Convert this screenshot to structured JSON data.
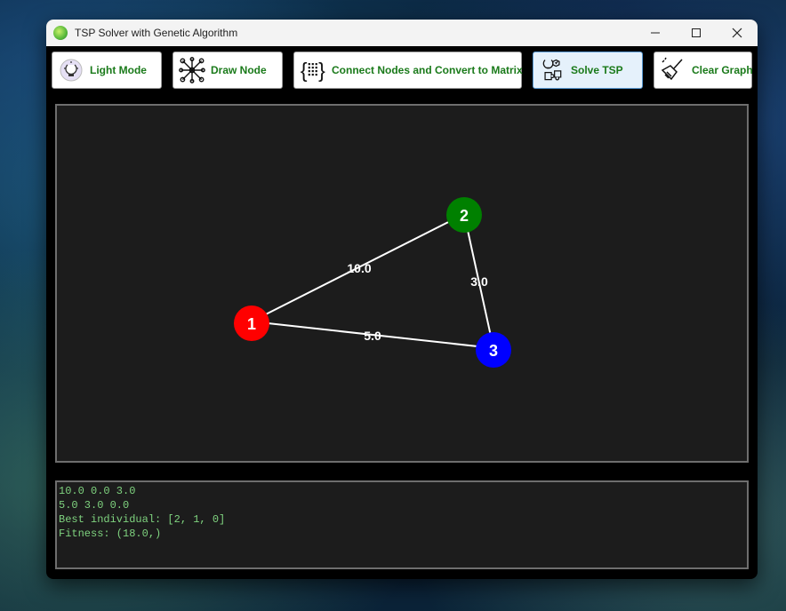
{
  "window": {
    "title": "TSP Solver with Genetic Algorithm",
    "controls": {
      "minimize": "—",
      "maximize": "☐",
      "close": "✕"
    }
  },
  "toolbar": {
    "buttons": [
      {
        "label": "Light Mode",
        "icon": "light-bulb-icon"
      },
      {
        "label": "Draw Node",
        "icon": "network-nodes-icon"
      },
      {
        "label": "Connect Nodes and Convert to Matrix",
        "icon": "matrix-braces-icon"
      },
      {
        "label": "Solve TSP",
        "icon": "puzzle-lightbulb-icon",
        "active": true
      },
      {
        "label": "Clear Graph",
        "icon": "broom-icon"
      }
    ],
    "label_color": "#1a7a1a"
  },
  "graph": {
    "nodes": [
      {
        "id": "1",
        "color": "#ff0000"
      },
      {
        "id": "2",
        "color": "#008000"
      },
      {
        "id": "3",
        "color": "#0000ff"
      }
    ],
    "edges": [
      {
        "from": "1",
        "to": "2",
        "weight": "10.0"
      },
      {
        "from": "2",
        "to": "3",
        "weight": "3.0"
      },
      {
        "from": "1",
        "to": "3",
        "weight": "5.0"
      }
    ],
    "edge_color": "#ffffff",
    "canvas_bg": "#1c1c1c"
  },
  "console": {
    "lines": [
      "10.0 0.0 3.0",
      "5.0 3.0 0.0",
      "Best individual: [2, 1, 0]",
      "Fitness: (18.0,)"
    ],
    "text_color": "#7fd37f"
  }
}
